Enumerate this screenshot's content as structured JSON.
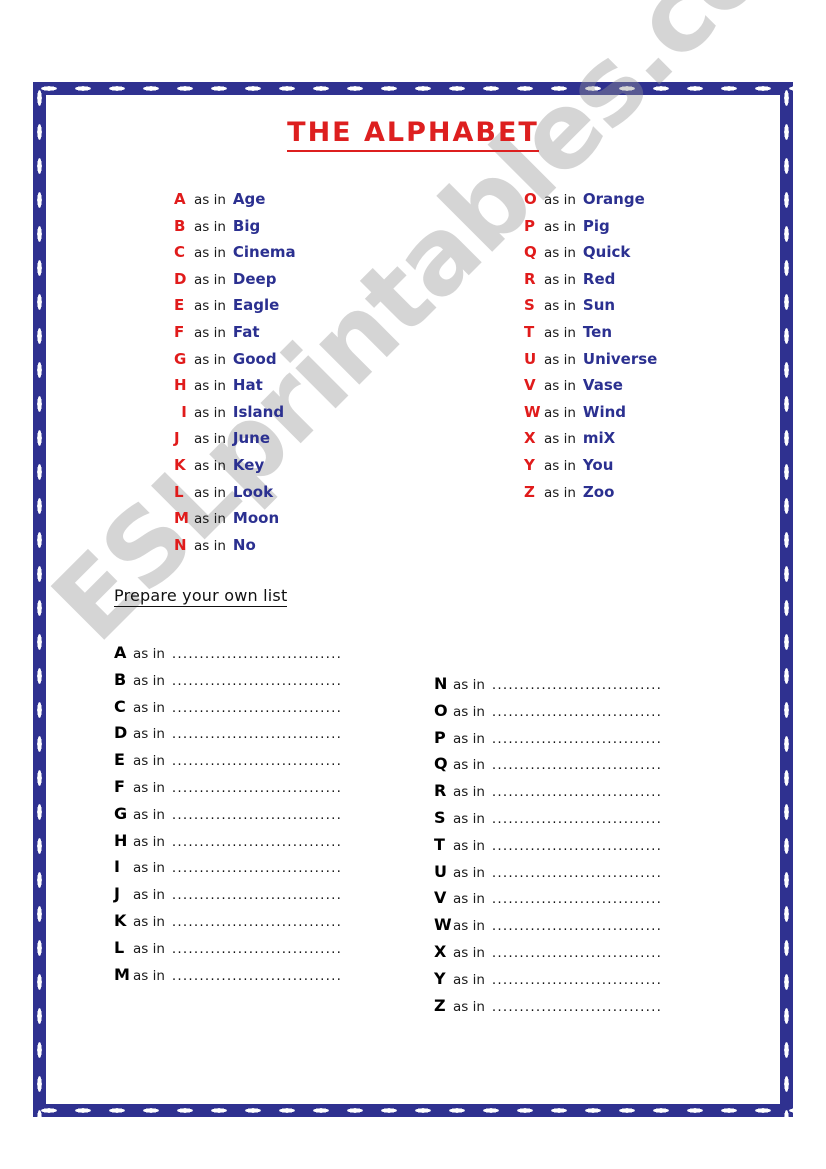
{
  "title": "THE ALPHABET",
  "watermark": "ESLprintables.com",
  "connector": "as in",
  "colors": {
    "frame": "#2f3190",
    "title_red": "#dd1f1f",
    "letter_red": "#e01b1b",
    "word_blue": "#2b3090",
    "text_black": "#111111",
    "watermark_gray": "#969696"
  },
  "examples": {
    "left_column": [
      {
        "letter": "A",
        "word": "Age"
      },
      {
        "letter": "B",
        "word": "Big"
      },
      {
        "letter": "C",
        "word": "Cinema"
      },
      {
        "letter": "D",
        "word": "Deep"
      },
      {
        "letter": "E",
        "word": "Eagle"
      },
      {
        "letter": "F",
        "word": "Fat"
      },
      {
        "letter": "G",
        "word": "Good"
      },
      {
        "letter": "H",
        "word": "Hat"
      },
      {
        "letter": "I",
        "word": "Island"
      },
      {
        "letter": "J",
        "word": "June"
      },
      {
        "letter": "K",
        "word": "Key"
      },
      {
        "letter": "L",
        "word": "Look"
      },
      {
        "letter": "M",
        "word": "Moon"
      },
      {
        "letter": "N",
        "word": "No"
      }
    ],
    "right_column": [
      {
        "letter": "O",
        "word": "Orange"
      },
      {
        "letter": "P",
        "word": "Pig"
      },
      {
        "letter": "Q",
        "word": "Quick"
      },
      {
        "letter": "R",
        "word": "Red"
      },
      {
        "letter": "S",
        "word": "Sun"
      },
      {
        "letter": "T",
        "word": "Ten"
      },
      {
        "letter": "U",
        "word": "Universe"
      },
      {
        "letter": "V",
        "word": "Vase"
      },
      {
        "letter": "W",
        "word": "Wind"
      },
      {
        "letter": "X",
        "word": "miX"
      },
      {
        "letter": "Y",
        "word": "You"
      },
      {
        "letter": "Z",
        "word": "Zoo"
      }
    ]
  },
  "prepare": {
    "heading": "Prepare your own list",
    "dots": "...............................",
    "left_column": [
      "A",
      "B",
      "C",
      "D",
      "E",
      "F",
      "G",
      "H",
      "I",
      "J",
      "K",
      "L",
      "M"
    ],
    "right_column": [
      "N",
      "O",
      "P",
      "Q",
      "R",
      "S",
      "T",
      "U",
      "V",
      "W",
      "X",
      "Y",
      "Z"
    ]
  }
}
